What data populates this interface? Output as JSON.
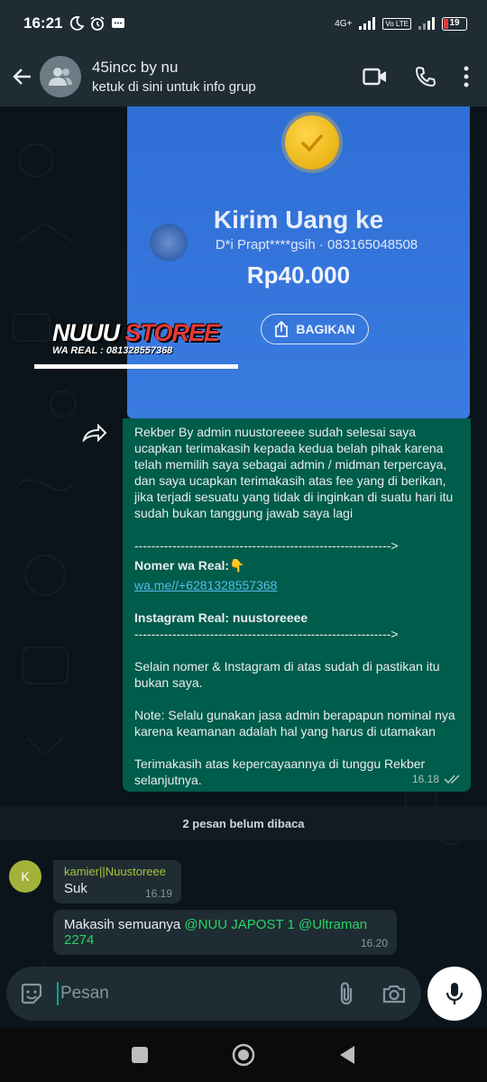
{
  "status_bar": {
    "time": "16:21",
    "network": "4G+",
    "volte": "Vo LTE",
    "battery": "19"
  },
  "header": {
    "title": "45incc by nu",
    "subtitle": "ketuk di sini untuk info grup"
  },
  "image_message": {
    "heading": "Kirim Uang ke",
    "recipient": "D*i Prapt****gsih · 083165048508",
    "amount": "Rp40.000",
    "share_label": "BAGIKAN",
    "watermark_title_1": "NUUU",
    "watermark_title_2": "STOREE",
    "watermark_sub": "WA REAL : 081328557368"
  },
  "outgoing_message": {
    "intro": "Rekber By admin nuustoreeee sudah selesai saya ucapkan terimakasih kepada kedua belah pihak karena telah memilih saya sebagai admin / midman terpercaya, dan saya ucapkan terimakasih atas fee yang di berikan, jika terjadi sesuatu yang tidak di inginkan di suatu hari itu sudah bukan tanggung jawab saya lagi",
    "divider": "------------------------------------------------------------->",
    "wa_label": "Nomer wa Real:",
    "wa_emoji": "👇",
    "wa_link": "wa.me//+6281328557368",
    "ig_label": "Instagram Real: nuustoreeee",
    "notice": "Selain nomer & Instagram di atas sudah di pastikan itu bukan saya.",
    "note": "Note: Selalu gunakan jasa admin berapapun nominal nya karena keamanan adalah hal yang harus di utamakan",
    "thanks": "Terimakasih atas kepercayaannya di tunggu Rekber selanjutnya.",
    "time": "16.18"
  },
  "unread_banner": "2 pesan belum dibaca",
  "incoming_messages": [
    {
      "avatar_letter": "K",
      "sender": "kamier||Nuustoreee",
      "text": "Suk",
      "time": "16.19"
    },
    {
      "text": "Makasih semuanya ",
      "mentions": "@NUU JAPOST 1 @Ultraman 2274",
      "time": "16.20"
    }
  ],
  "composer": {
    "placeholder": "Pesan"
  },
  "colors": {
    "outgoing_bubble": "#005c4b",
    "incoming_bubble": "#202c33",
    "accent": "#00a884",
    "link": "#53bdeb",
    "mention": "#25d366"
  }
}
